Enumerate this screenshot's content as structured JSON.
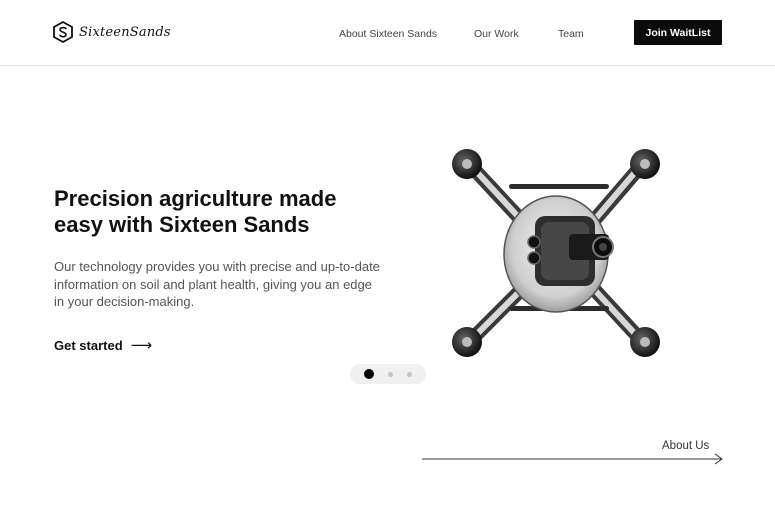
{
  "header": {
    "logo_text": "SixteenSands",
    "nav": {
      "about": "About Sixteen Sands",
      "work": "Our Work",
      "team": "Team"
    },
    "cta_label": "Join WaitList"
  },
  "hero": {
    "title": "Precision agriculture made easy with Sixteen Sands",
    "subtitle": "Our technology provides you with precise and up-to-date information on soil and plant health, giving you an edge in your decision-making.",
    "cta_label": "Get started",
    "cta_arrow": "⟶"
  },
  "carousel": {
    "slide_count": 3,
    "active_index": 0
  },
  "about_link": "About Us",
  "colors": {
    "primary": "#0b0b0b",
    "text": "#111111",
    "muted": "#555555",
    "dot_inactive": "#c2c2c2",
    "dots_bg": "#f0f0f0"
  }
}
